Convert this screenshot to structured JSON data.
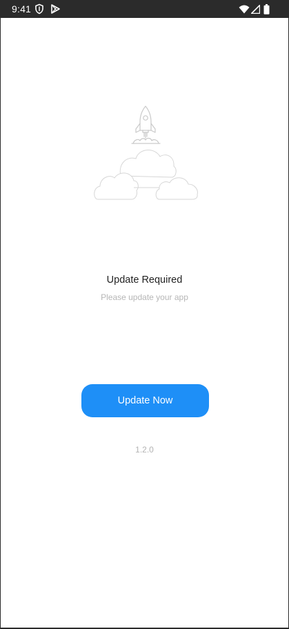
{
  "status_bar": {
    "time": "9:41",
    "icons": [
      "shield-icon",
      "play-store-icon",
      "wifi-icon",
      "signal-icon",
      "battery-icon"
    ]
  },
  "illustration": {
    "icons": [
      "rocket-icon",
      "clouds-icon"
    ],
    "stroke_color": "#c9c9c9"
  },
  "update": {
    "title": "Update Required",
    "subtitle": "Please update your app",
    "button_label": "Update Now",
    "version": "1.2.0"
  },
  "colors": {
    "accent": "#1e8ff7",
    "status_bar": "#2b2b2b",
    "background": "#ffffff"
  }
}
